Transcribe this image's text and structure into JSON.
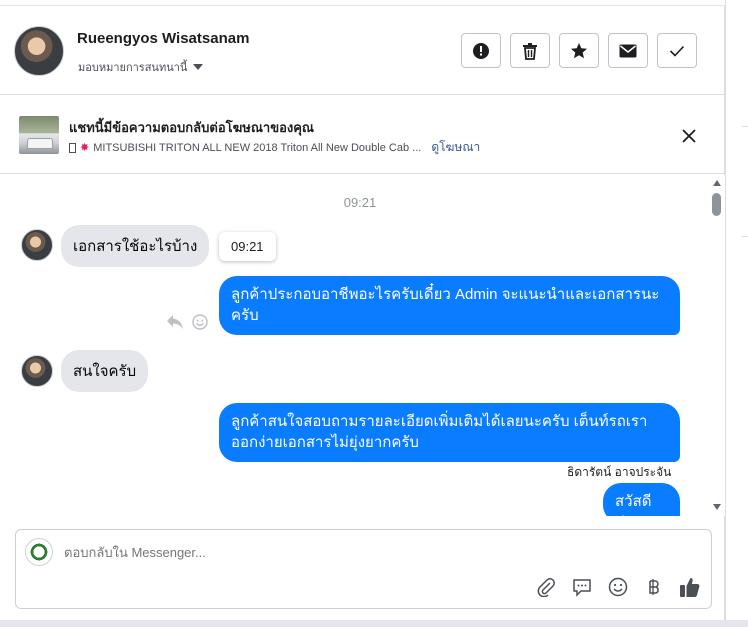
{
  "header": {
    "name": "Rueengyos Wisatsanam",
    "assign_label": "มอบหมายการสนทนานี้"
  },
  "ad": {
    "title": "แชทนี้มีข้อความตอบกลับต่อโฆษณาของคุณ",
    "subtitle": "MITSUBISHI TRITON ALL NEW 2018 Triton All New Double Cab ...",
    "link": "ดูโฆษณา"
  },
  "messages": {
    "timestamp": "09:21",
    "tooltip": "09:21",
    "in1": "เอกสารใช้อะไรบ้าง",
    "out1": "ลูกค้าประกอบอาชีพอะไรครับเดี๋ยว Admin จะแนะนำและเอกสารนะครับ",
    "in2": "สนใจครับ",
    "out2": "ลูกค้าสนใจสอบถามรายละเอียดเพิ่มเติมได้เลยนะครับ เต็นท์รถเรา ออกง่ายเอกสารไม่ยุ่งยากครับ",
    "sender": "ธิดารัตน์ อาจประจัน",
    "out3": "สวัสดีค่ะ"
  },
  "composer": {
    "placeholder": "ตอบกลับใน Messenger..."
  },
  "colors": {
    "accent": "#0a7cff",
    "incoming": "#e4e6eb"
  },
  "icons": [
    "alert-icon",
    "trash-icon",
    "star-icon",
    "mail-icon",
    "check-icon",
    "close-icon",
    "reply-icon",
    "smile-icon",
    "paperclip-icon",
    "chat-bubble-icon",
    "emoji-icon",
    "baht-icon",
    "thumbs-up-icon"
  ]
}
